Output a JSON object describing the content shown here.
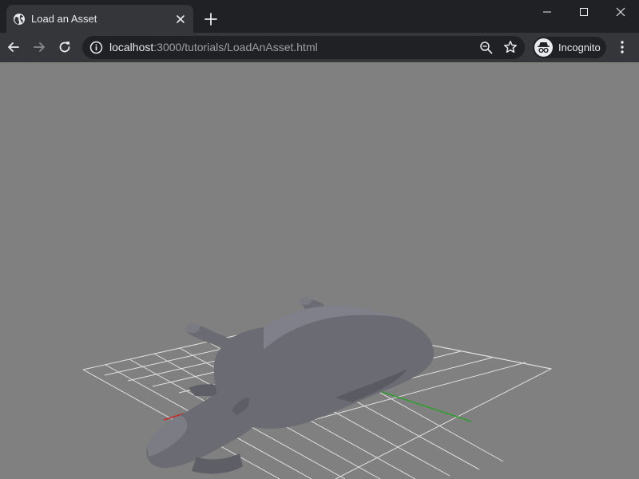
{
  "browser": {
    "tab": {
      "title": "Load an Asset"
    },
    "address_bar": {
      "host": "localhost",
      "path": ":3000/tutorials/LoadAnAsset.html"
    },
    "profile": {
      "label": "Incognito"
    },
    "icons": {
      "favicon": "globe-icon",
      "tab_close": "close-icon",
      "new_tab": "plus-icon",
      "back": "arrow-left-icon",
      "forward": "arrow-right-icon",
      "reload": "reload-icon",
      "site_info": "info-icon",
      "zoom": "zoom-out-icon",
      "bookmark": "star-icon",
      "menu": "kebab-menu-icon"
    },
    "colors": {
      "frame": "#202124",
      "toolbar": "#35363a",
      "text": "#e8eaed",
      "muted_text": "#9aa0a6"
    }
  },
  "scene": {
    "background": "#808080",
    "model": "cow",
    "model_color": "#6b6b73",
    "grid_color": "#e0e0e0",
    "x_axis_color": "#c62828",
    "z_axis_color": "#2e9e2e"
  }
}
